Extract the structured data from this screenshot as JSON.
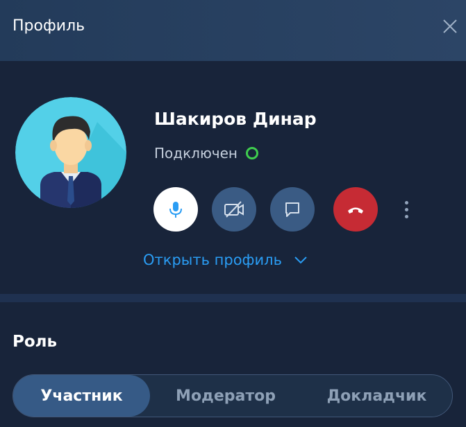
{
  "header": {
    "title": "Профиль",
    "close_icon": "close-icon"
  },
  "profile": {
    "name": "Шакиров Динар",
    "status": "Подключен",
    "status_color": "#3fce4e",
    "avatar_icon": "user-avatar-icon",
    "actions": {
      "mic_icon": "microphone-icon",
      "camera_icon": "camera-off-icon",
      "chat_icon": "chat-icon",
      "hangup_icon": "phone-hangup-icon",
      "more_icon": "more-vertical-icon"
    },
    "open_profile_label": "Открыть профиль"
  },
  "role": {
    "title": "Роль",
    "options": [
      "Участник",
      "Модератор",
      "Докладчик"
    ],
    "selected": "Участник"
  },
  "colors": {
    "background": "#18243a",
    "header": "#2a4262",
    "accent": "#2a9df4",
    "hangup": "#c62b34",
    "action_button": "#3a5b84"
  }
}
